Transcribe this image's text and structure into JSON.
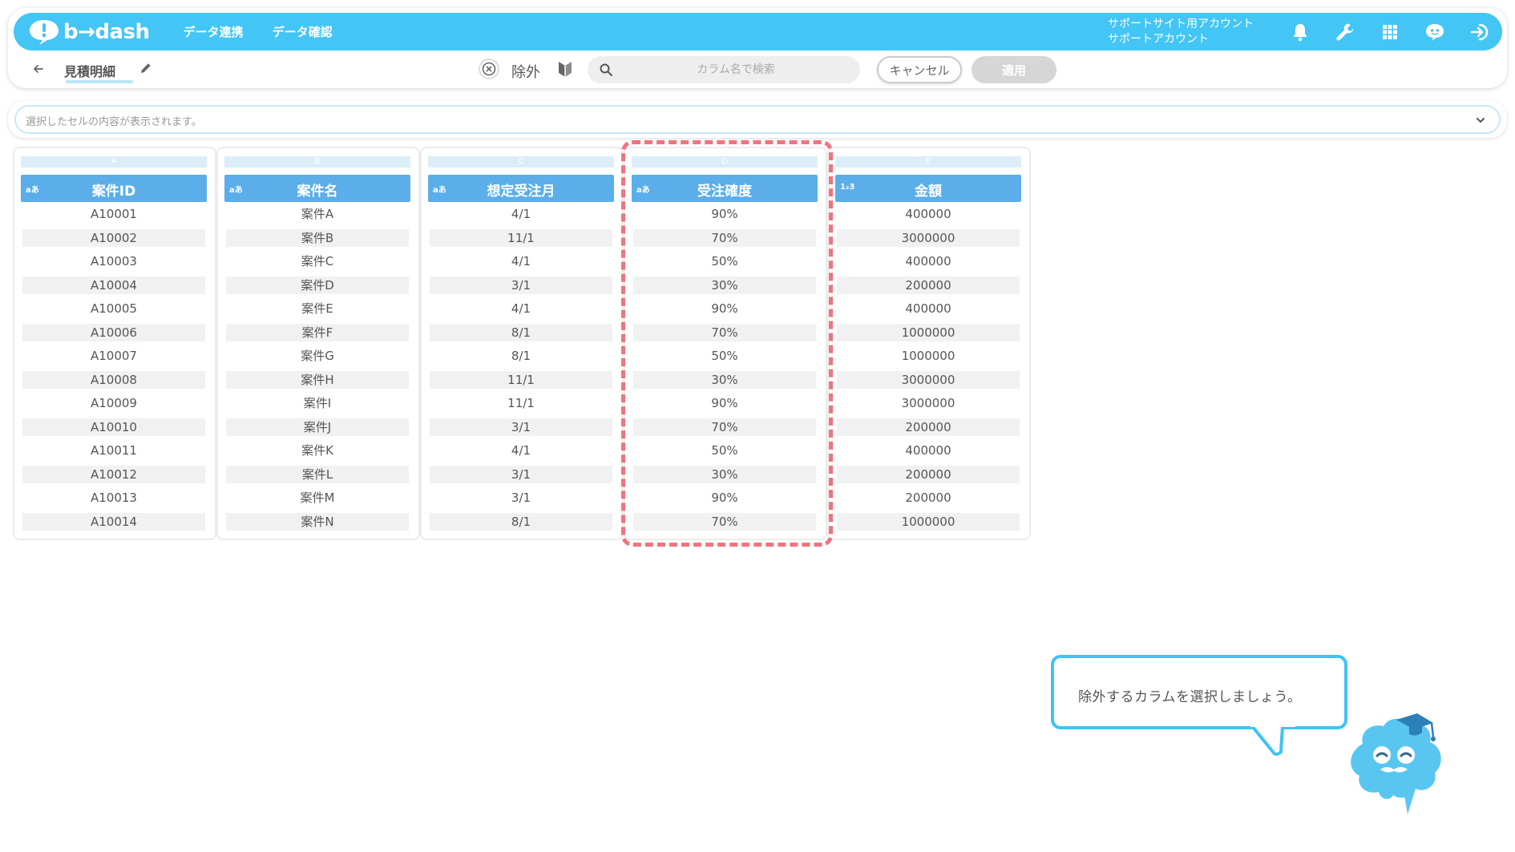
{
  "app": {
    "logo_text": "b→dash",
    "nav_links": [
      "データ連携",
      "データ確認"
    ],
    "account_line1": "サポートサイト用アカウント",
    "account_line2": "サポートアカウント"
  },
  "toolbar": {
    "sheet_name": "見積明細",
    "exclude_label": "除外",
    "search_placeholder": "カラム名で検索",
    "cancel_label": "キャンセル",
    "apply_label": "適用"
  },
  "cell_bar": {
    "placeholder": "選択したセルの内容が表示されます。"
  },
  "columns": [
    {
      "letter": "A",
      "type": "aあ",
      "title": "案件ID",
      "values": [
        "A10001",
        "A10002",
        "A10003",
        "A10004",
        "A10005",
        "A10006",
        "A10007",
        "A10008",
        "A10009",
        "A10010",
        "A10011",
        "A10012",
        "A10013",
        "A10014"
      ]
    },
    {
      "letter": "B",
      "type": "aあ",
      "title": "案件名",
      "values": [
        "案件A",
        "案件B",
        "案件C",
        "案件D",
        "案件E",
        "案件F",
        "案件G",
        "案件H",
        "案件I",
        "案件J",
        "案件K",
        "案件L",
        "案件M",
        "案件N"
      ]
    },
    {
      "letter": "C",
      "type": "aあ",
      "title": "想定受注月",
      "values": [
        "4/1",
        "11/1",
        "4/1",
        "3/1",
        "4/1",
        "8/1",
        "8/1",
        "11/1",
        "11/1",
        "3/1",
        "4/1",
        "3/1",
        "3/1",
        "8/1"
      ]
    },
    {
      "letter": "D",
      "type": "aあ",
      "title": "受注確度",
      "values": [
        "90%",
        "70%",
        "50%",
        "30%",
        "90%",
        "70%",
        "50%",
        "30%",
        "90%",
        "70%",
        "50%",
        "30%",
        "90%",
        "70%"
      ]
    },
    {
      "letter": "E",
      "type": "1₂3",
      "title": "金額",
      "values": [
        "400000",
        "3000000",
        "400000",
        "200000",
        "400000",
        "1000000",
        "1000000",
        "3000000",
        "3000000",
        "200000",
        "400000",
        "200000",
        "200000",
        "1000000"
      ]
    }
  ],
  "highlighted_column": "D",
  "tooltip": {
    "text": "除外するカラムを選択しましょう。"
  },
  "icons": {
    "notifications": "bell-icon",
    "settings": "wrench-icon",
    "apps": "grid-icon",
    "support": "chat-bot-icon",
    "logout": "logout-icon"
  },
  "colors": {
    "nav_bg": "#43c5f6",
    "column_header": "#5baeea",
    "highlight_border": "#f0737e",
    "tooltip_border": "#3ec3f4"
  }
}
